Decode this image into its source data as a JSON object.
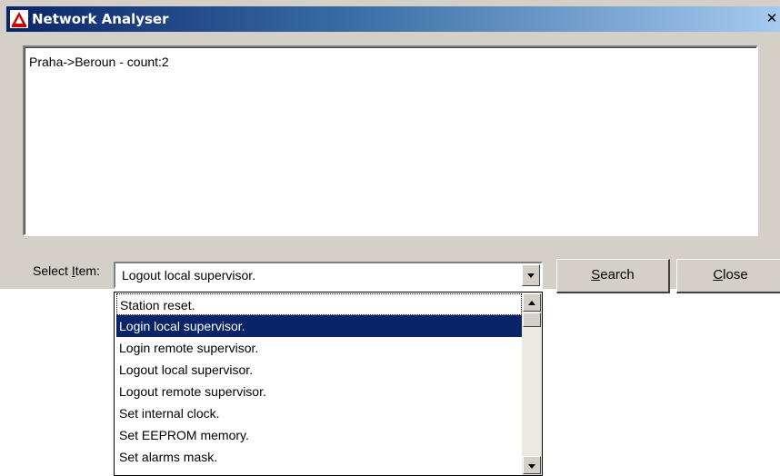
{
  "window": {
    "title": "Network Analyser",
    "close_glyph": "✕",
    "app_icon": "app-logo-icon"
  },
  "output": {
    "lines": [
      "Praha->Beroun - count:2"
    ]
  },
  "select": {
    "label_pre": "Select ",
    "label_accel": "I",
    "label_post": "tem:",
    "value": "Logout local supervisor.",
    "options": [
      "Station reset.",
      "Login local supervisor.",
      "Login remote supervisor.",
      "Logout local supervisor.",
      "Logout remote supervisor.",
      "Set internal clock.",
      "Set EEPROM memory.",
      "Set alarms mask."
    ],
    "highlighted_index": 1,
    "focused_index": 0
  },
  "buttons": {
    "search_accel": "S",
    "search_rest": "earch",
    "close_accel": "C",
    "close_rest": "lose"
  },
  "colors": {
    "selection": "#0a246a",
    "face": "#d4d0c8"
  }
}
